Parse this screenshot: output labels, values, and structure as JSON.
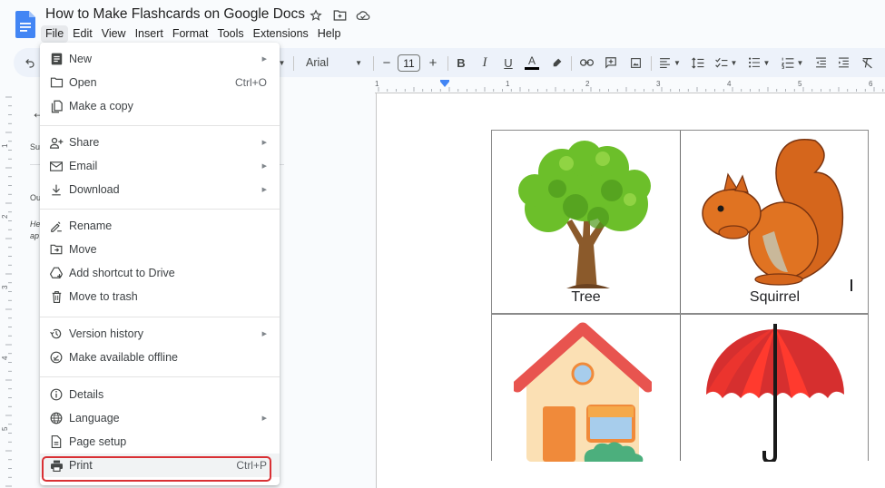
{
  "app": {
    "doc_title": "How to Make Flashcards on Google Docs",
    "title_icons": [
      "star-icon",
      "move-folder-icon",
      "cloud-saved-icon"
    ],
    "brand_color": "#4285f4"
  },
  "menubar": {
    "items": [
      {
        "label": "File",
        "active": true
      },
      {
        "label": "Edit"
      },
      {
        "label": "View"
      },
      {
        "label": "Insert"
      },
      {
        "label": "Format"
      },
      {
        "label": "Tools"
      },
      {
        "label": "Extensions"
      },
      {
        "label": "Help"
      }
    ]
  },
  "toolbar": {
    "font_name": "Arial",
    "font_size": "11",
    "minus": "−",
    "plus": "+",
    "bold": "B",
    "italic": "I",
    "underline": "U",
    "text_color": "A",
    "text_color_value": "#000000"
  },
  "ruler": {
    "labels": [
      "1",
      "1",
      "2",
      "3",
      "4",
      "5",
      "6"
    ],
    "vertical_labels": [
      "1",
      "2",
      "3",
      "4",
      "5"
    ]
  },
  "outline": {
    "summary_label": "Su",
    "outline_label": "Ou",
    "hint_line1": "He",
    "hint_line2": "ap"
  },
  "file_menu": {
    "groups": [
      [
        {
          "label": "New",
          "icon": "new-doc-icon",
          "submenu": true
        },
        {
          "label": "Open",
          "icon": "folder-icon",
          "shortcut": "Ctrl+O"
        },
        {
          "label": "Make a copy",
          "icon": "copy-icon"
        }
      ],
      [
        {
          "label": "Share",
          "icon": "share-person-icon",
          "submenu": true
        },
        {
          "label": "Email",
          "icon": "email-icon",
          "submenu": true
        },
        {
          "label": "Download",
          "icon": "download-icon",
          "submenu": true
        }
      ],
      [
        {
          "label": "Rename",
          "icon": "rename-icon"
        },
        {
          "label": "Move",
          "icon": "move-folder-icon"
        },
        {
          "label": "Add shortcut to Drive",
          "icon": "drive-shortcut-icon"
        },
        {
          "label": "Move to trash",
          "icon": "trash-icon"
        }
      ],
      [
        {
          "label": "Version history",
          "icon": "history-icon",
          "submenu": true
        },
        {
          "label": "Make available offline",
          "icon": "offline-icon"
        }
      ],
      [
        {
          "label": "Details",
          "icon": "info-icon"
        },
        {
          "label": "Language",
          "icon": "globe-icon",
          "submenu": true
        },
        {
          "label": "Page setup",
          "icon": "page-setup-icon"
        },
        {
          "label": "Print",
          "icon": "printer-icon",
          "shortcut": "Ctrl+P",
          "highlighted": true
        }
      ]
    ],
    "highlight_color": "#d93034"
  },
  "flashcards": {
    "cards": [
      {
        "label": "Tree",
        "image": "tree-image"
      },
      {
        "label": "Squirrel",
        "image": "squirrel-image"
      },
      {
        "label": "",
        "image": "house-image"
      },
      {
        "label": "",
        "image": "umbrella-image"
      }
    ]
  }
}
